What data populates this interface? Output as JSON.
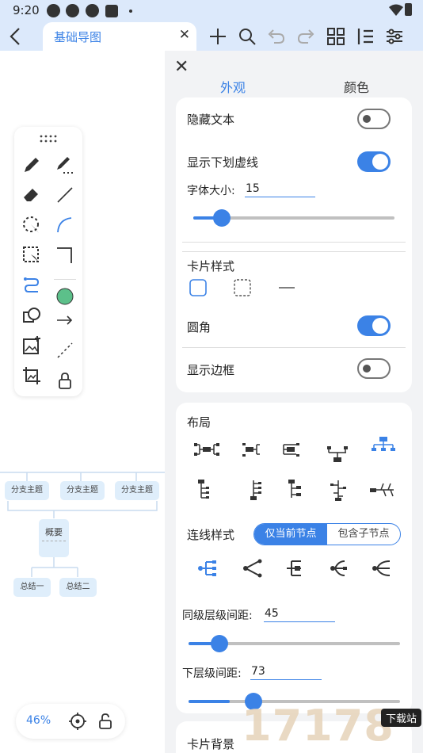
{
  "status_bar": {
    "time": "9:20"
  },
  "toolbar": {
    "tab_title": "基础导图",
    "close_glyph": "✕"
  },
  "canvas": {
    "branch_topics": [
      "分支主题",
      "分支主题",
      "分支主题"
    ],
    "summary_label": "概要",
    "conclusions": [
      "总结一",
      "总结二"
    ],
    "zoom_level": "46%"
  },
  "panel": {
    "close_glyph": "✕",
    "tabs": [
      "外观",
      "颜色"
    ],
    "active_tab": "外观",
    "hide_text_label": "隐藏文本",
    "hide_text_on": false,
    "show_underline_label": "显示下划虚线",
    "show_underline_on": true,
    "font_size_label": "字体大小:",
    "font_size_value": "15",
    "card_style_label": "卡片样式",
    "rounded_label": "圆角",
    "rounded_on": true,
    "show_border_label": "显示边框",
    "show_border_on": false,
    "layout_label": "布局",
    "line_style_label": "连线样式",
    "line_style_options": [
      "仅当前节点",
      "包含子节点"
    ],
    "sibling_spacing_label": "同级层级间距:",
    "sibling_spacing_value": "45",
    "child_spacing_label": "下层级间距:",
    "child_spacing_value": "73",
    "card_background_label": "卡片背景"
  },
  "watermark": {
    "text": "17178",
    "badge": "下载站"
  },
  "colors": {
    "accent": "#3b82e6",
    "bar_bg": "#dce9fb",
    "panel_bg": "#f2f3f5",
    "node_bg": "#dfeefb",
    "node_green": "#5cc08a"
  }
}
